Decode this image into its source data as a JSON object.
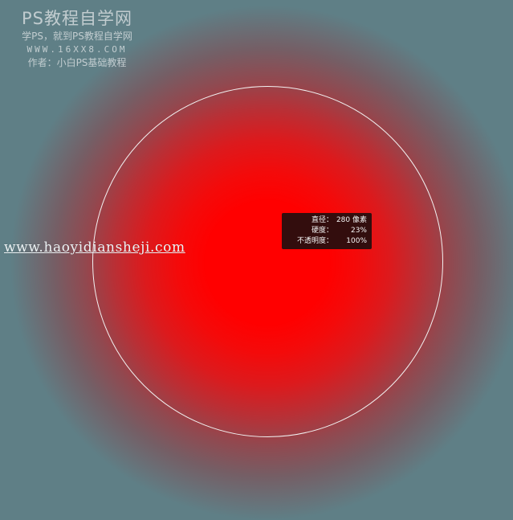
{
  "watermark": {
    "title": "PS教程自学网",
    "subtitle": "学PS，就到PS教程自学网",
    "url": "WWW.16XX8.COM",
    "author": "作者：小白PS基础教程"
  },
  "site_watermark": "www.haoyidiansheji.com",
  "brush_hud": {
    "diameter_label": "直径：",
    "diameter_value": "280 像素",
    "hardness_label": "硬度：",
    "hardness_value": "23%",
    "opacity_label": "不透明度：",
    "opacity_value": "100%"
  },
  "colors": {
    "background": "#5f7f86",
    "brush_color": "#ff0000",
    "outline": "#f2f2f2"
  }
}
